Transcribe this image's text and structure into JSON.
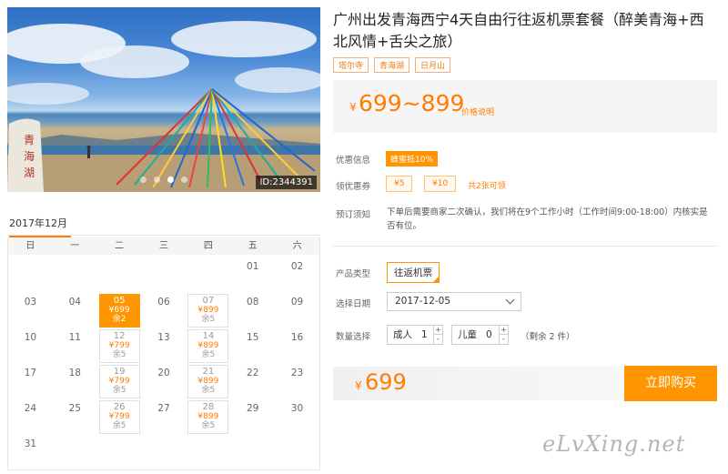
{
  "hero": {
    "id_label": "ID:2344391",
    "rock_text": "青海湖",
    "dots": [
      false,
      false,
      true,
      false
    ]
  },
  "product": {
    "title": "广州出发青海西宁4天自由行往返机票套餐（醉美青海+西北风情+舌尖之旅）",
    "tags": [
      "塔尔寺",
      "青海湖",
      "日月山"
    ]
  },
  "price": {
    "currency": "¥",
    "range": "699~899",
    "note": "价格说明"
  },
  "labels": {
    "discount": "优惠信息",
    "coupon": "领优惠券",
    "booking_notice": "预订须知",
    "product_type": "产品类型",
    "select_date": "选择日期",
    "quantity": "数量选择"
  },
  "discount_badge": "蜂蜜抵10%",
  "coupons": [
    "¥5",
    "¥10"
  ],
  "coupon_link": "共2张可领",
  "booking_notice_text": "下单后需要商家二次确认，我们将在9个工作小时（工作时间9:00-18:00）内核实是否有位。",
  "product_type_value": "往返机票",
  "selected_date": "2017-12-05",
  "quantity": {
    "adult_label": "成人",
    "adult_value": "1",
    "child_label": "儿童",
    "child_value": "0",
    "plus": "+",
    "minus": "-",
    "remaining": "（剩余 2 件）"
  },
  "total": {
    "currency": "¥",
    "amount": "699"
  },
  "buy_button": "立即购买",
  "watermark": "eLvXing.net",
  "calendar": {
    "month": "2017年12月",
    "weekdays": [
      "日",
      "一",
      "二",
      "三",
      "四",
      "五",
      "六"
    ],
    "weeks": [
      [
        {
          "d": ""
        },
        {
          "d": ""
        },
        {
          "d": ""
        },
        {
          "d": ""
        },
        {
          "d": ""
        },
        {
          "d": "01"
        },
        {
          "d": "02"
        }
      ],
      [
        {
          "d": "03"
        },
        {
          "d": "04"
        },
        {
          "d": "05",
          "p": "¥699",
          "s": "余2",
          "sel": true
        },
        {
          "d": "06"
        },
        {
          "d": "07",
          "p": "¥899",
          "s": "余5"
        },
        {
          "d": "08"
        },
        {
          "d": "09"
        }
      ],
      [
        {
          "d": "10"
        },
        {
          "d": "11"
        },
        {
          "d": "12",
          "p": "¥799",
          "s": "余5"
        },
        {
          "d": "13"
        },
        {
          "d": "14",
          "p": "¥899",
          "s": "余5"
        },
        {
          "d": "15"
        },
        {
          "d": "16"
        }
      ],
      [
        {
          "d": "17"
        },
        {
          "d": "18"
        },
        {
          "d": "19",
          "p": "¥799",
          "s": "余5"
        },
        {
          "d": "20"
        },
        {
          "d": "21",
          "p": "¥899",
          "s": "余5"
        },
        {
          "d": "22"
        },
        {
          "d": "23"
        }
      ],
      [
        {
          "d": "24"
        },
        {
          "d": "25"
        },
        {
          "d": "26",
          "p": "¥799",
          "s": "余5"
        },
        {
          "d": "27"
        },
        {
          "d": "28",
          "p": "¥899",
          "s": "余5"
        },
        {
          "d": "29"
        },
        {
          "d": "30"
        }
      ],
      [
        {
          "d": "31"
        },
        {
          "d": ""
        },
        {
          "d": ""
        },
        {
          "d": ""
        },
        {
          "d": ""
        },
        {
          "d": ""
        },
        {
          "d": ""
        }
      ]
    ]
  }
}
